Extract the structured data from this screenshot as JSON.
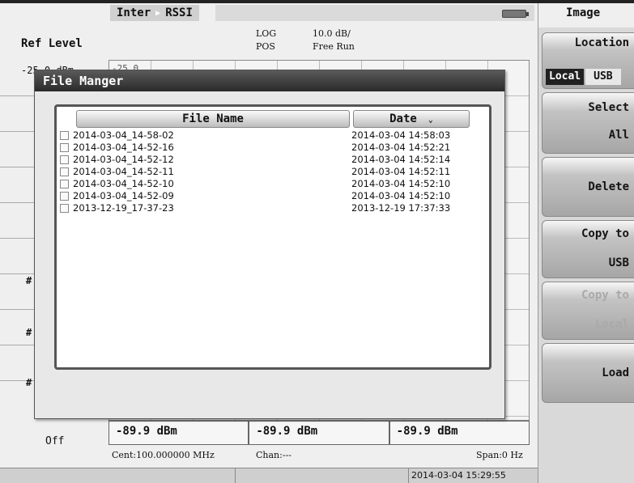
{
  "header": {
    "tab_mode": "Inter",
    "tab_measure": "RSSI",
    "scale_type": "LOG",
    "scale_div": "10.0 dB/",
    "trigger_slope": "POS",
    "trigger_mode": "Free Run"
  },
  "ref": {
    "label": "Ref Level",
    "value": "-25.0 dBm",
    "plot_top": "-25.0"
  },
  "markers": {
    "hash": "#",
    "m1": "-89.9 dBm",
    "m2": "-89.9 dBm",
    "m3": "-89.9 dBm",
    "state": "Off"
  },
  "footer": {
    "center": "Cent:100.000000 MHz",
    "chan": "Chan:---",
    "span": "Span:0 Hz",
    "clock": "2014-03-04 15:29:55"
  },
  "menu": {
    "title": "Image",
    "location_label": "Location",
    "local": "Local",
    "usb": "USB",
    "select_label": "Select",
    "select_value": "All",
    "delete": "Delete",
    "copy_usb_1": "Copy to",
    "copy_usb_2": "USB",
    "copy_local_1": "Copy to",
    "copy_local_2": "Local",
    "load": "Load"
  },
  "dialog": {
    "title": "File Manger",
    "col_name": "File Name",
    "col_date": "Date",
    "files": [
      {
        "name": "2014-03-04_14-58-02",
        "date": "2014-03-04 14:58:03",
        "checked": false
      },
      {
        "name": "2014-03-04_14-52-16",
        "date": "2014-03-04 14:52:21",
        "checked": false
      },
      {
        "name": "2014-03-04_14-52-12",
        "date": "2014-03-04 14:52:14",
        "checked": false
      },
      {
        "name": "2014-03-04_14-52-11",
        "date": "2014-03-04 14:52:11",
        "checked": false
      },
      {
        "name": "2014-03-04_14-52-10",
        "date": "2014-03-04 14:52:10",
        "checked": false
      },
      {
        "name": "2014-03-04_14-52-09",
        "date": "2014-03-04 14:52:10",
        "checked": false
      },
      {
        "name": "2013-12-19_17-37-23",
        "date": "2013-12-19 17:37:33",
        "checked": false
      }
    ]
  }
}
